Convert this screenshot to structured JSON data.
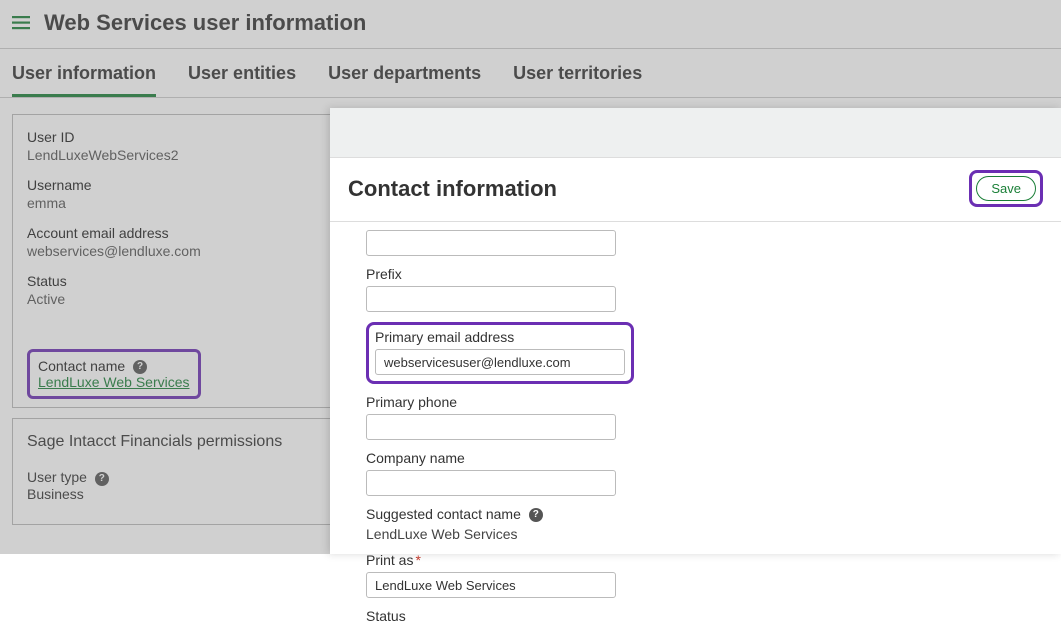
{
  "header": {
    "title": "Web Services user information"
  },
  "tabs": [
    {
      "label": "User information",
      "active": true
    },
    {
      "label": "User entities",
      "active": false
    },
    {
      "label": "User departments",
      "active": false
    },
    {
      "label": "User territories",
      "active": false
    }
  ],
  "userInfo": {
    "userIdLabel": "User ID",
    "userId": "LendLuxeWebServices2",
    "usernameLabel": "Username",
    "username": "emma",
    "accountEmailLabel": "Account email address",
    "accountEmail": "webservices@lendluxe.com",
    "statusLabel": "Status",
    "status": "Active",
    "contactNameLabel": "Contact name",
    "contactName": "LendLuxe Web Services"
  },
  "permissionsPanel": {
    "title": "Sage Intacct Financials permissions",
    "userTypeLabel": "User type",
    "userType": "Business"
  },
  "modal": {
    "title": "Contact information",
    "saveLabel": "Save",
    "fields": {
      "prefixLabel": "Prefix",
      "prefix": "",
      "primaryEmailLabel": "Primary email address",
      "primaryEmail": "webservicesuser@lendluxe.com",
      "primaryPhoneLabel": "Primary phone",
      "primaryPhone": "",
      "companyNameLabel": "Company name",
      "companyName": "",
      "suggestedContactLabel": "Suggested contact name",
      "suggestedContact": "LendLuxe Web Services",
      "printAsLabel": "Print as",
      "printAs": "LendLuxe Web Services",
      "statusLabel": "Status"
    }
  }
}
